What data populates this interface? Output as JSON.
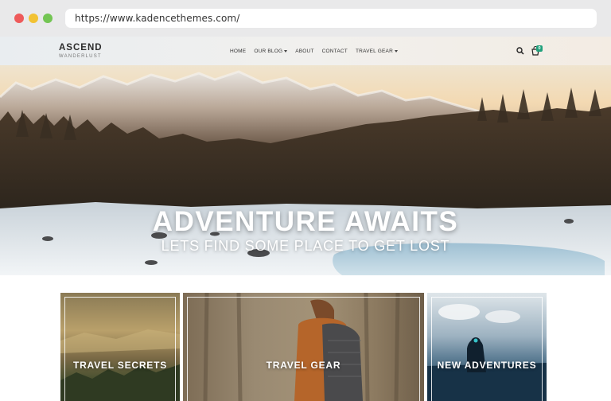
{
  "browser": {
    "url": "https://www.kadencethemes.com/"
  },
  "site": {
    "logo_title": "ASCEND",
    "logo_subtitle": "WANDERLUST",
    "nav": [
      {
        "label": "HOME",
        "has_dropdown": false
      },
      {
        "label": "OUR BLOG",
        "has_dropdown": true
      },
      {
        "label": "ABOUT",
        "has_dropdown": false
      },
      {
        "label": "CONTACT",
        "has_dropdown": false
      },
      {
        "label": "TRAVEL GEAR",
        "has_dropdown": true
      }
    ],
    "cart_count": "0",
    "icons": [
      "search-icon",
      "cart-icon"
    ]
  },
  "hero": {
    "title": "ADVENTURE AWAITS",
    "subtitle": "LETS FIND SOME PLACE TO GET LOST"
  },
  "cards": [
    {
      "label": "TRAVEL SECRETS"
    },
    {
      "label": "TRAVEL GEAR"
    },
    {
      "label": "NEW ADVENTURES"
    }
  ],
  "colors": {
    "badge": "#21a17c",
    "close_dot": "#ee5a5a",
    "minimize_dot": "#f2c233",
    "maximize_dot": "#73c553"
  }
}
